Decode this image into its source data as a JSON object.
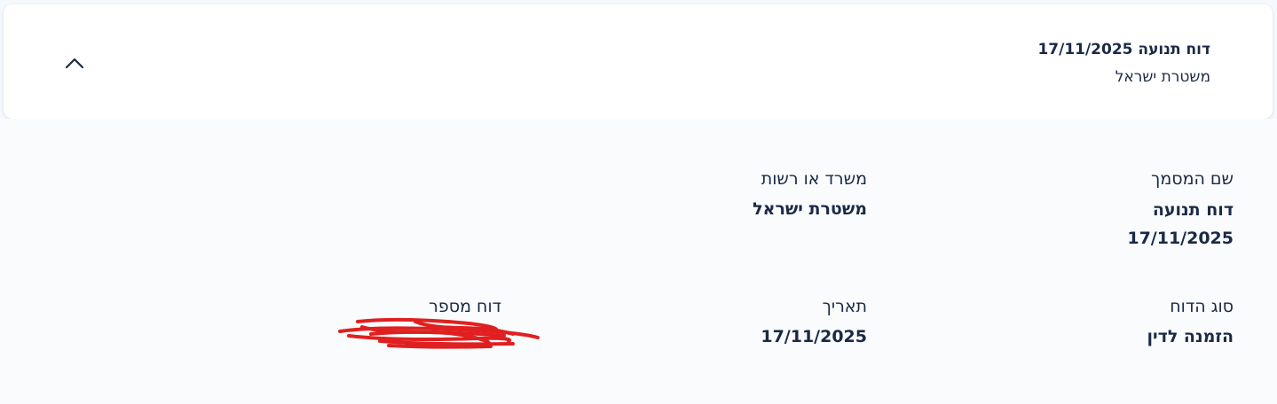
{
  "header": {
    "title": "דוח תנועה 17/11/2025",
    "subtitle": "משטרת ישראל",
    "collapse_icon": "chevron-up-icon"
  },
  "details": {
    "document_name": {
      "label": "שם המסמך",
      "value_line1": "דוח תנועה",
      "value_line2": "17/11/2025"
    },
    "office": {
      "label": "משרד או רשות",
      "value": "משטרת ישראל"
    },
    "report_type": {
      "label": "סוג הדוח",
      "value": "הזמנה לדין"
    },
    "date": {
      "label": "תאריך",
      "value": "17/11/2025"
    },
    "report_number": {
      "label": "דוח מספר",
      "value": "",
      "redaction_color": "#e02020"
    }
  }
}
